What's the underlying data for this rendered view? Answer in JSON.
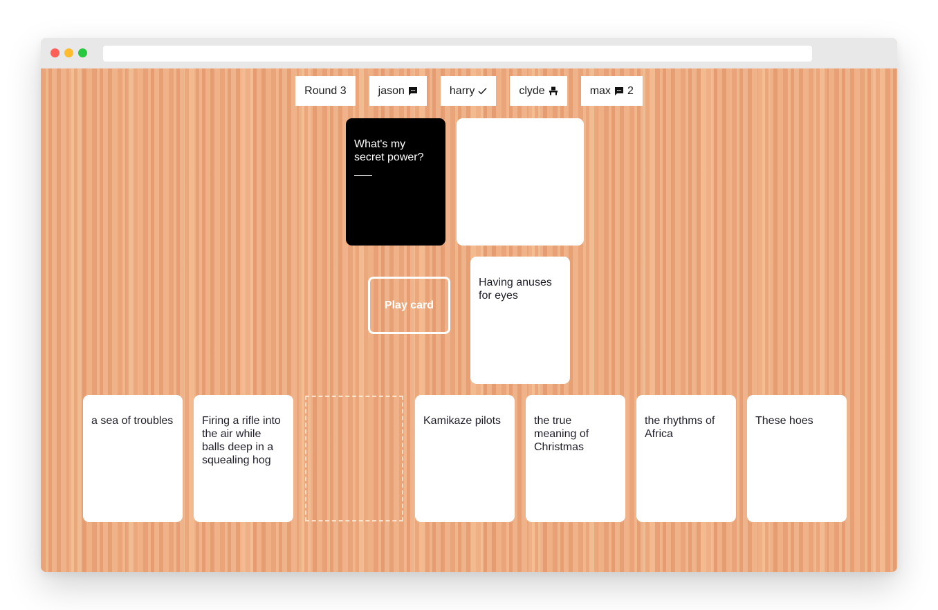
{
  "window": {
    "url": ""
  },
  "scoreboard": {
    "round_label": "Round 3",
    "players": [
      {
        "name": "jason",
        "status_icon": "chat-bubble-icon",
        "count": ""
      },
      {
        "name": "harry",
        "status_icon": "checkmark-icon",
        "count": ""
      },
      {
        "name": "clyde",
        "status_icon": "judge-chair-icon",
        "count": ""
      },
      {
        "name": "max",
        "status_icon": "chat-bubble-icon",
        "count": "2"
      }
    ]
  },
  "board": {
    "black_card": {
      "text": "What's my secret power?",
      "blank": "____"
    },
    "answer_slot": {
      "text": ""
    },
    "selected_card": {
      "text": "Having anuses for eyes"
    },
    "play_button_label": "Play card"
  },
  "hand": [
    {
      "text": "a sea of troubles"
    },
    {
      "text": "Firing a rifle into the air while balls deep in a squealing hog"
    },
    {
      "text": ""
    },
    {
      "text": "Kamikaze pilots"
    },
    {
      "text": "the true meaning of Christmas"
    },
    {
      "text": "the rhythms of Africa"
    },
    {
      "text": "These hoes"
    }
  ],
  "colors": {
    "table": "#e9a479",
    "black_card": "#000000",
    "white_card": "#ffffff"
  }
}
